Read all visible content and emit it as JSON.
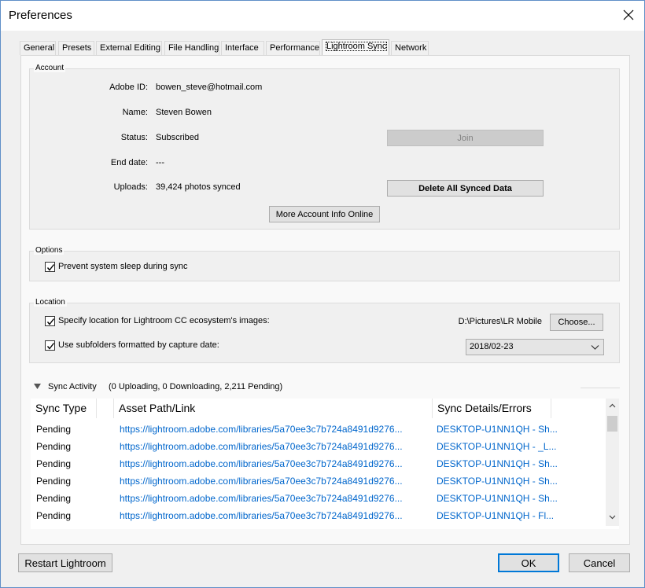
{
  "window": {
    "title": "Preferences"
  },
  "tabs": [
    {
      "label": "General"
    },
    {
      "label": "Presets"
    },
    {
      "label": "External Editing"
    },
    {
      "label": "File Handling"
    },
    {
      "label": "Interface"
    },
    {
      "label": "Performance"
    },
    {
      "label": "Lightroom Sync",
      "active": true
    },
    {
      "label": "Network"
    }
  ],
  "account": {
    "group_label": "Account",
    "adobe_id_label": "Adobe ID:",
    "adobe_id_value": "bowen_steve@hotmail.com",
    "name_label": "Name:",
    "name_value": "Steven Bowen",
    "status_label": "Status:",
    "status_value": "Subscribed",
    "end_date_label": "End date:",
    "end_date_value": "---",
    "uploads_label": "Uploads:",
    "uploads_value": "39,424 photos synced",
    "join_button": "Join",
    "delete_button": "Delete All Synced Data",
    "more_info_button": "More Account Info Online"
  },
  "options": {
    "group_label": "Options",
    "prevent_sleep_label": "Prevent system sleep during sync",
    "prevent_sleep_checked": true
  },
  "location": {
    "group_label": "Location",
    "specify_label": "Specify location for Lightroom CC ecosystem's images:",
    "specify_checked": true,
    "path_value": "D:\\Pictures\\LR Mobile",
    "choose_button": "Choose...",
    "subfolders_label": "Use subfolders formatted by capture date:",
    "subfolders_checked": true,
    "date_format_value": "2018/02-23"
  },
  "sync_activity": {
    "label": "Sync Activity",
    "summary": "(0 Uploading, 0 Downloading, 2,211 Pending)",
    "columns": [
      "Sync Type",
      "Asset Path/Link",
      "Sync Details/Errors"
    ],
    "rows": [
      {
        "type": "Pending",
        "path": "https://lightroom.adobe.com/libraries/5a70ee3c7b724a8491d9276...",
        "details": "DESKTOP-U1NN1QH  - Sh..."
      },
      {
        "type": "Pending",
        "path": "https://lightroom.adobe.com/libraries/5a70ee3c7b724a8491d9276...",
        "details": "DESKTOP-U1NN1QH  - _L..."
      },
      {
        "type": "Pending",
        "path": "https://lightroom.adobe.com/libraries/5a70ee3c7b724a8491d9276...",
        "details": "DESKTOP-U1NN1QH  - Sh..."
      },
      {
        "type": "Pending",
        "path": "https://lightroom.adobe.com/libraries/5a70ee3c7b724a8491d9276...",
        "details": "DESKTOP-U1NN1QH  - Sh..."
      },
      {
        "type": "Pending",
        "path": "https://lightroom.adobe.com/libraries/5a70ee3c7b724a8491d9276...",
        "details": "DESKTOP-U1NN1QH  - Sh..."
      },
      {
        "type": "Pending",
        "path": "https://lightroom.adobe.com/libraries/5a70ee3c7b724a8491d9276...",
        "details": "DESKTOP-U1NN1QH  - Fl..."
      }
    ]
  },
  "footer": {
    "restart_button": "Restart Lightroom",
    "ok_button": "OK",
    "cancel_button": "Cancel"
  },
  "colors": {
    "link": "#0066cc",
    "primary_border": "#0078d7",
    "window_border": "#5f8fc7",
    "disabled_button": "#cccccc"
  }
}
